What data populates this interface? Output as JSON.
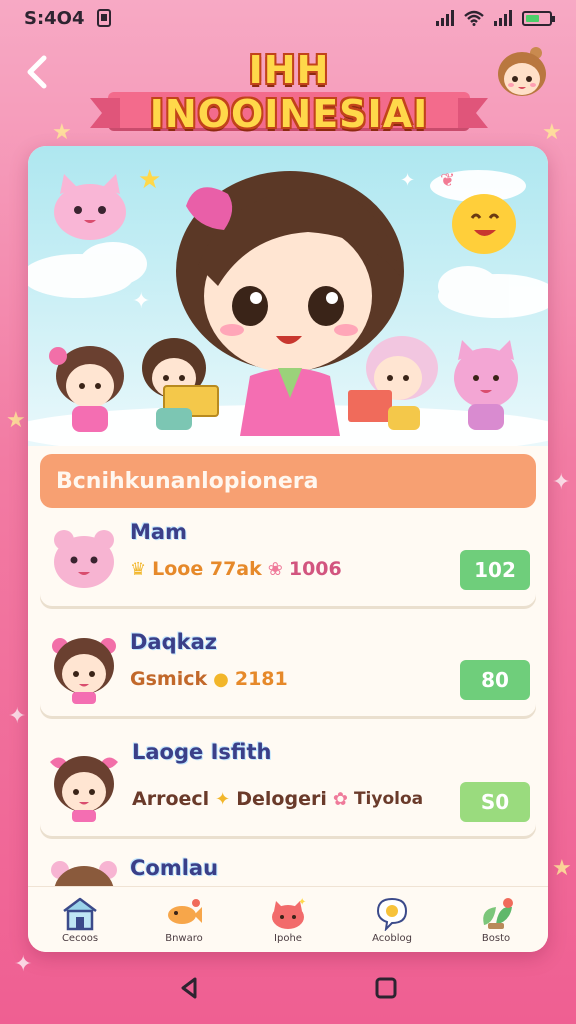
{
  "status_bar": {
    "time": "S:4O4",
    "notification_icon": "sim-card-icon",
    "signal_icons": [
      "signal-icon",
      "wifi-icon",
      "signal-icon"
    ],
    "battery_level": 0.6
  },
  "header": {
    "back_icon": "chevron-left-icon",
    "title": "IHH INOOINESIAI",
    "avatar_icon": "girl-avatar-icon"
  },
  "section": {
    "title": "Bcnihkunanlopionera"
  },
  "list": [
    {
      "title": "Mam",
      "thumb_icon": "pink-bear-icon",
      "meta": [
        "Looe 77ak",
        "1006"
      ],
      "meta_icons": [
        "crown-icon",
        "paw-icon"
      ],
      "score": "102"
    },
    {
      "title": "Daqkaz",
      "thumb_icon": "girl-with-bow-icon",
      "meta": [
        "Gsmick",
        "2181"
      ],
      "meta_icons": [
        "",
        "coin-icon"
      ],
      "score": "80"
    },
    {
      "title": "Laoge Isfith",
      "thumb_icon": "girl-with-pink-bow-icon",
      "meta": [
        "Arroecl",
        "Delogeri",
        "Tiyoloa"
      ],
      "meta_icons": [
        "",
        "star-icon",
        "flower-icon"
      ],
      "score": "S0"
    },
    {
      "title": "Comlau",
      "thumb_icon": "bear-icon",
      "meta": [],
      "meta_icons": [],
      "score": ""
    }
  ],
  "bottom_nav": [
    {
      "label": "Cecoos",
      "icon": "house-icon"
    },
    {
      "label": "Bnwaro",
      "icon": "fish-icon"
    },
    {
      "label": "Ipohe",
      "icon": "cat-face-icon"
    },
    {
      "label": "Acoblog",
      "icon": "chat-bubble-icon"
    },
    {
      "label": "Bosto",
      "icon": "plant-icon"
    }
  ],
  "colors": {
    "background_top": "#f7a9c4",
    "background_bottom": "#ef5f92",
    "title_text": "#ffd84a",
    "ribbon": "#f36b8c",
    "section_header": "#f7a072",
    "score_green": "#6fce7b",
    "item_title": "#3b3f88"
  }
}
